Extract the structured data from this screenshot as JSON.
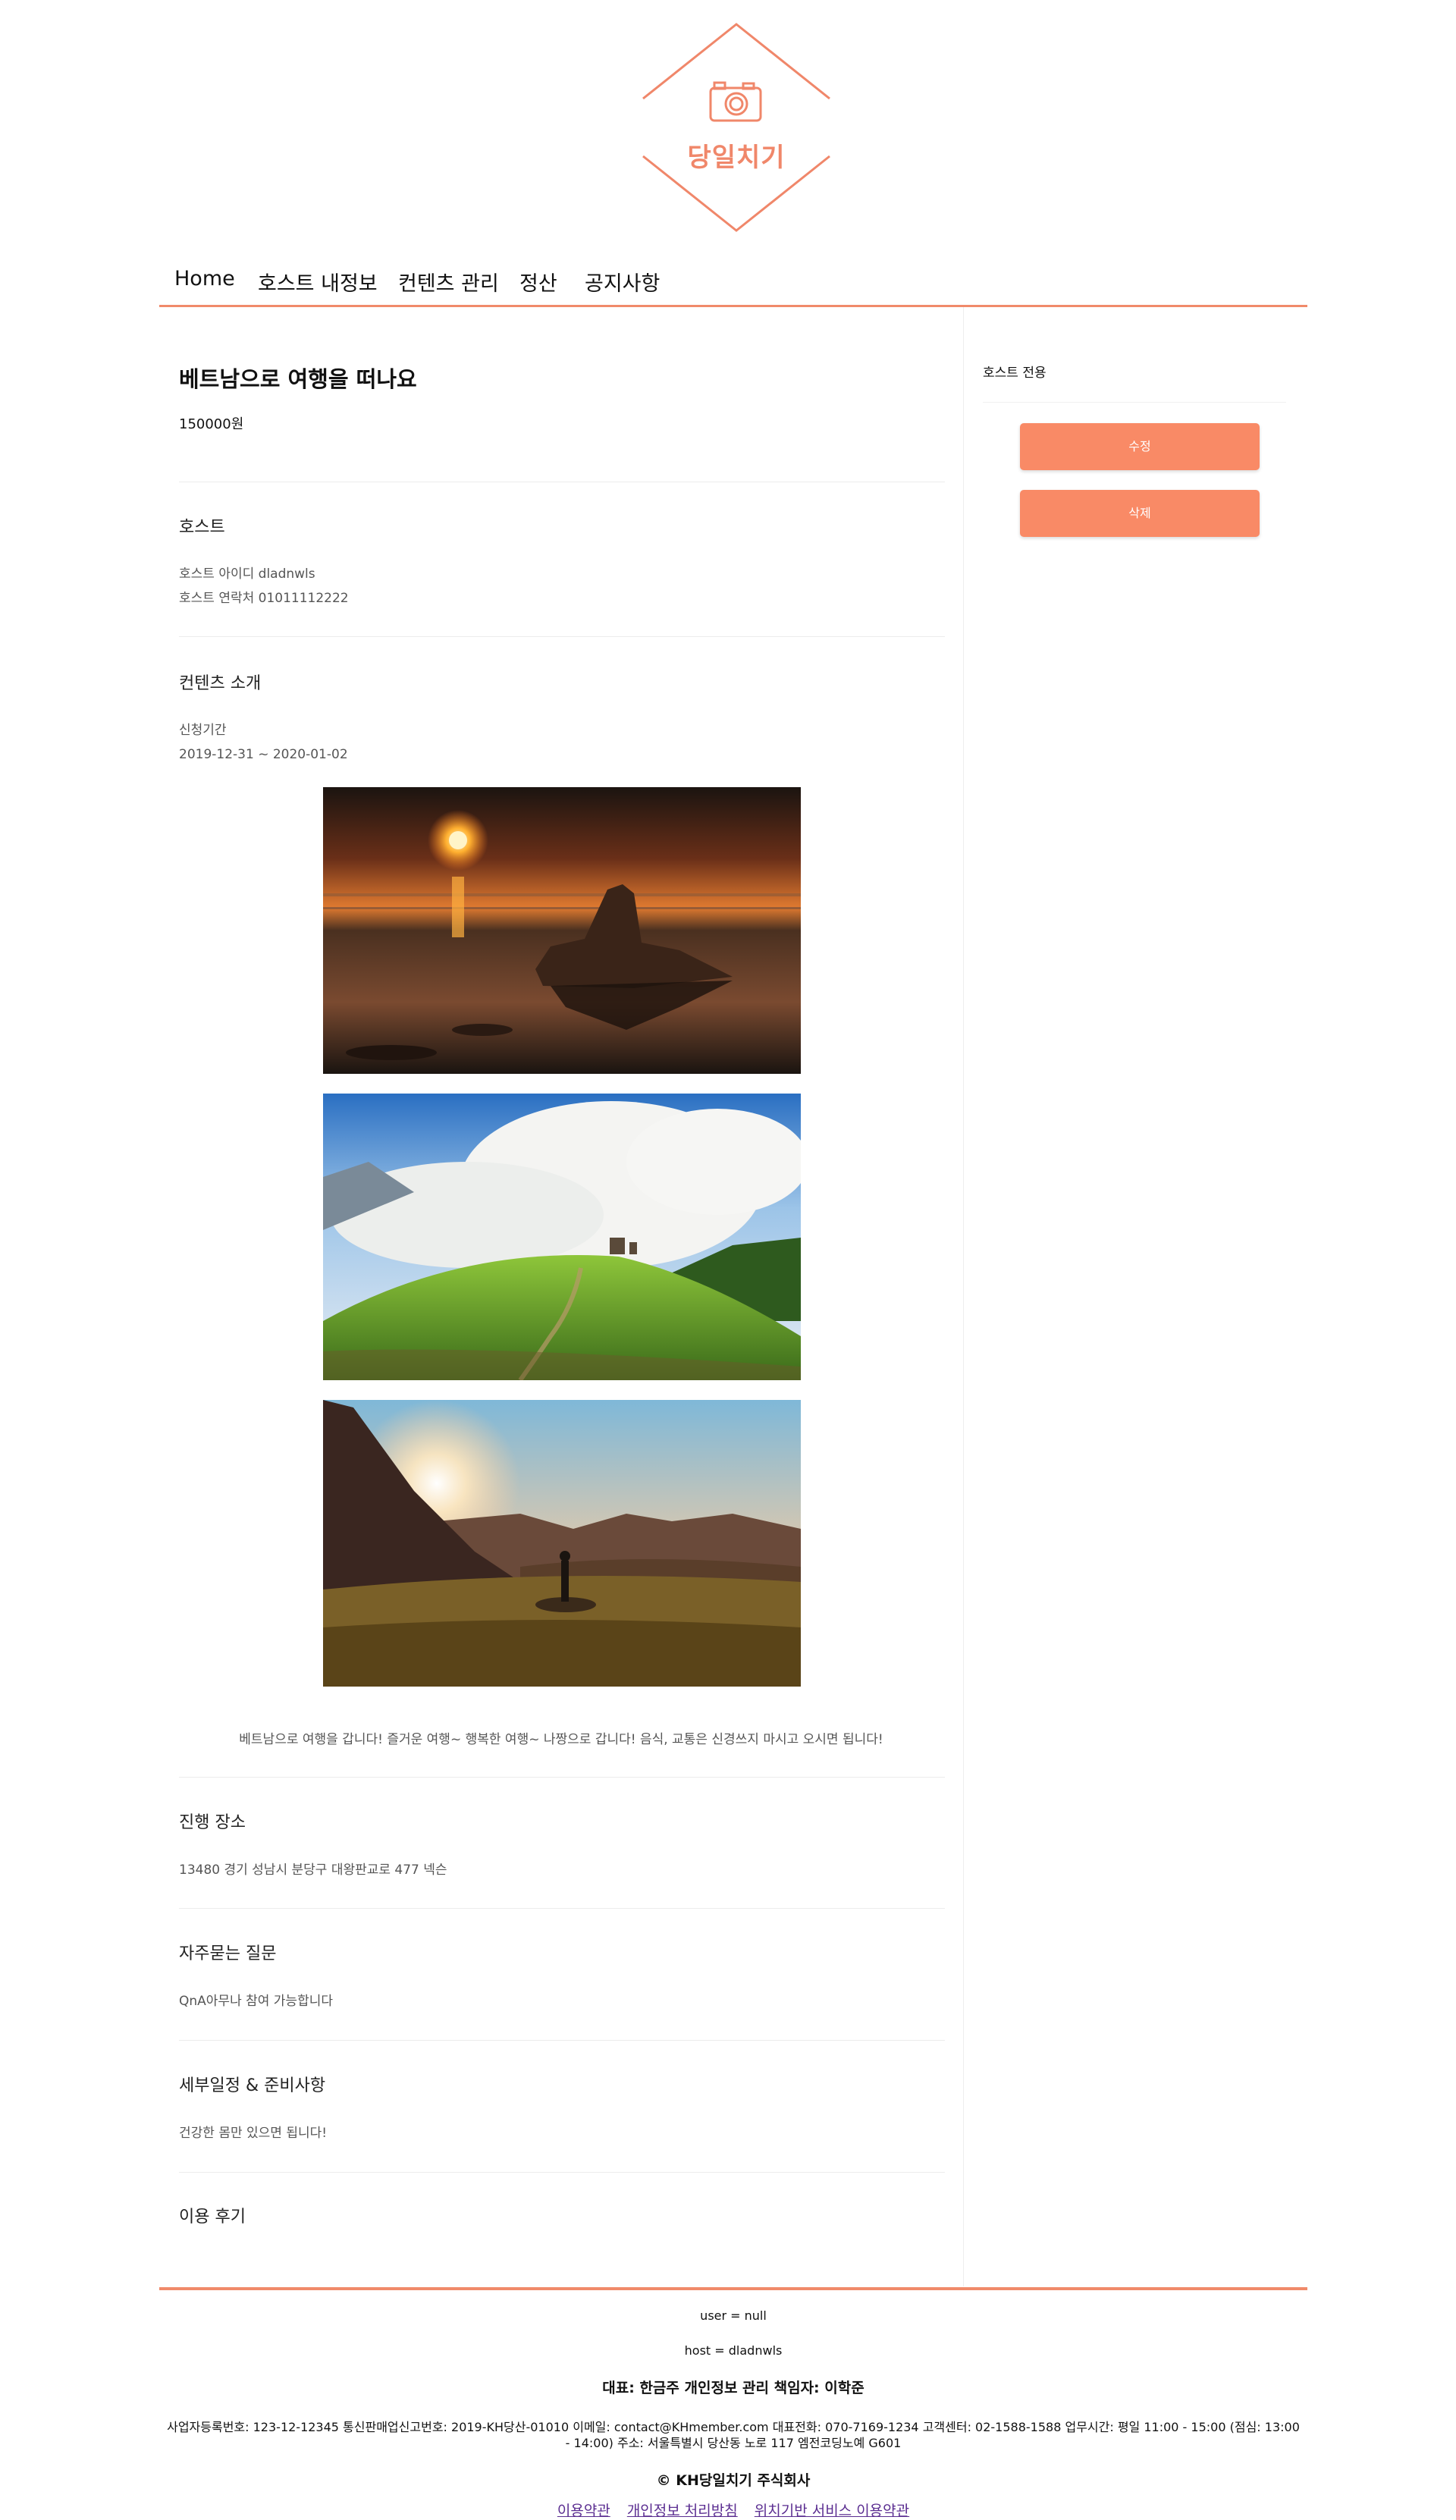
{
  "brand": {
    "name": "당일치기",
    "accent": "#f98a66"
  },
  "nav": {
    "items": [
      {
        "label": "Home"
      },
      {
        "label": "호스트 내정보"
      },
      {
        "label": "컨텐츠 관리"
      },
      {
        "label": "정산"
      },
      {
        "label": "공지사항"
      }
    ]
  },
  "content": {
    "title": "베트남으로 여행을 떠나요",
    "price": "150000원",
    "host_heading": "호스트",
    "host_id": "호스트 아이디 dladnwls",
    "host_contact": "호스트 연락처 01011112222",
    "intro_heading": "컨텐츠 소개",
    "period_label": "신청기간",
    "period_value": "2019-12-31 ~ 2020-01-02",
    "description": "베트남으로 여행을 갑니다! 즐거운 여행~ 행복한 여행~ 나짱으로 갑니다! 음식, 교통은 신경쓰지 마시고 오시면 됩니다!",
    "place_heading": "진행 장소",
    "place_value": "13480 경기 성남시 분당구 대왕판교로 477 넥슨",
    "faq_heading": "자주묻는 질문",
    "faq_value": "QnA아무나 참여 가능합니다",
    "schedule_heading": "세부일정 & 준비사항",
    "schedule_value": "건강한 몸만 있으면 됩니다!",
    "review_heading": "이용 후기"
  },
  "sidebar": {
    "label": "호스트 전용",
    "edit_button": "수정",
    "delete_button": "삭제"
  },
  "footer": {
    "user_line": "user = null",
    "host_line": "host = dladnwls",
    "rep_line": "대표: 한금주 개인정보 관리 책임자: 이학준",
    "biz_line": "사업자등록번호: 123-12-12345 통신판매업신고번호: 2019-KH당산-01010 이메일: contact@KHmember.com 대표전화: 070-7169-1234 고객센터: 02-1588-1588 업무시간: 평일 11:00 - 15:00 (점심: 13:00 - 14:00) 주소: 서울특별시 당산동 노로 117 엠전코딩노예 G601",
    "copyright": "© KH당일치기 주식회사",
    "links": [
      {
        "label": "이용약관"
      },
      {
        "label": "개인정보 처리방침"
      },
      {
        "label": "위치기반 서비스 이용약관"
      }
    ]
  }
}
